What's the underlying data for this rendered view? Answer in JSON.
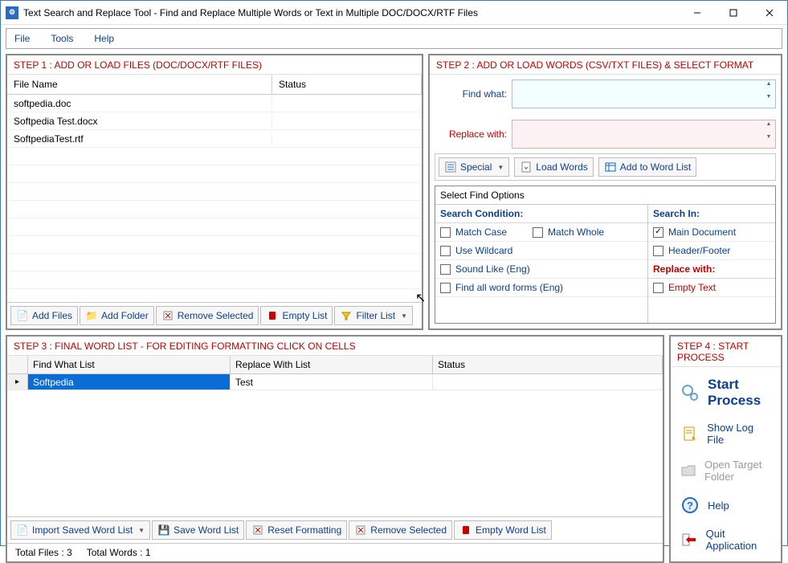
{
  "window": {
    "title": "Text Search and Replace Tool  - Find and Replace Multiple Words or Text  in Multiple DOC/DOCX/RTF Files"
  },
  "menubar": {
    "file": "File",
    "tools": "Tools",
    "help": "Help"
  },
  "step1": {
    "title": "STEP 1 : ADD OR LOAD FILES (DOC/DOCX/RTF FILES)",
    "cols": {
      "filename": "File Name",
      "status": "Status"
    },
    "rows": [
      {
        "filename": "softpedia.doc",
        "status": ""
      },
      {
        "filename": "Softpedia Test.docx",
        "status": ""
      },
      {
        "filename": "SoftpediaTest.rtf",
        "status": ""
      }
    ],
    "toolbar": {
      "add_files": "Add Files",
      "add_folder": "Add Folder",
      "remove_selected": "Remove Selected",
      "empty_list": "Empty List",
      "filter_list": "Filter List"
    }
  },
  "step2": {
    "title": "STEP 2 : ADD OR LOAD WORDS (CSV/TXT FILES) & SELECT FORMAT",
    "find_label": "Find what:",
    "replace_label": "Replace with:",
    "toolbar": {
      "special": "Special",
      "load_words": "Load Words",
      "add_to_list": "Add to Word List"
    },
    "opts_title": "Select Find Options",
    "cond_head": "Search Condition:",
    "in_head": "Search In:",
    "replace_head": "Replace with:",
    "opts": {
      "match_case": "Match Case",
      "match_whole": "Match Whole",
      "use_wildcard": "Use Wildcard",
      "sound_like": "Sound Like (Eng)",
      "find_forms": "Find all word forms (Eng)",
      "main_doc": "Main Document",
      "header_footer": "Header/Footer",
      "empty_text": "Empty Text"
    }
  },
  "step3": {
    "title": "STEP 3 : FINAL WORD LIST - FOR EDITING FORMATTING CLICK ON CELLS",
    "cols": {
      "find": "Find What List",
      "replace": "Replace With List",
      "status": "Status"
    },
    "rows": [
      {
        "find": "Softpedia",
        "replace": "Test",
        "status": ""
      }
    ],
    "toolbar": {
      "import": "Import Saved Word List",
      "save": "Save Word List",
      "reset": "Reset Formatting",
      "remove": "Remove Selected",
      "empty": "Empty Word List"
    },
    "status": {
      "files": "Total Files : 3",
      "words": "Total Words : 1"
    }
  },
  "step4": {
    "title": "STEP 4 : START PROCESS",
    "start": "Start Process",
    "log": "Show Log File",
    "target": "Open Target Folder",
    "help": "Help",
    "quit": "Quit Application"
  }
}
